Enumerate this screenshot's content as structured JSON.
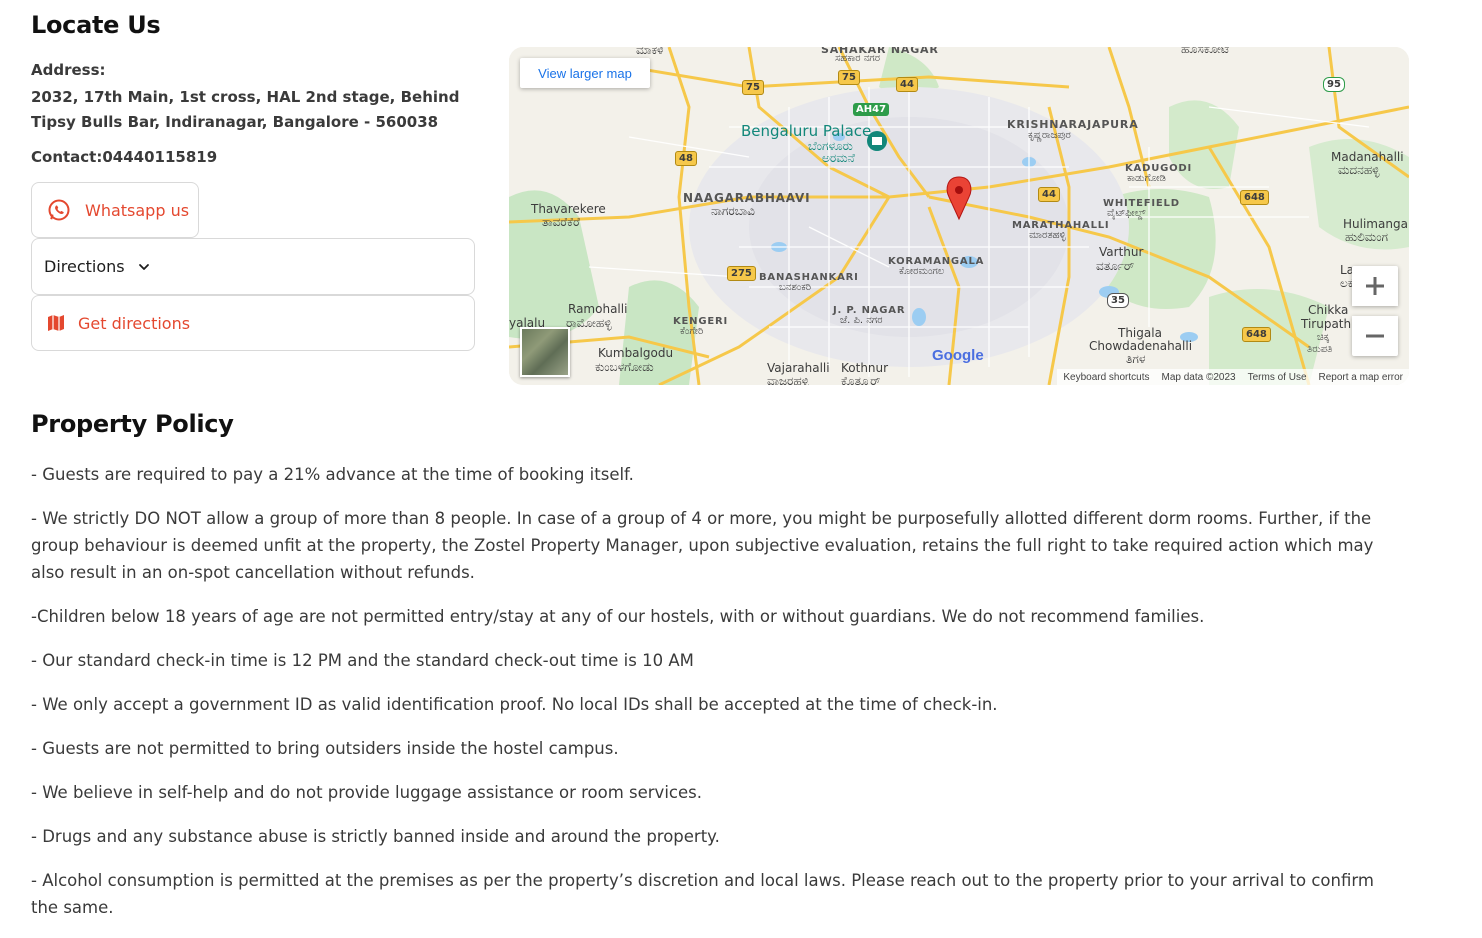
{
  "locate": {
    "title": "Locate Us",
    "address_label": "Address:",
    "address_text": "2032, 17th Main, 1st cross, HAL 2nd stage, Behind Tipsy Bulls Bar, Indiranagar, Bangalore - 560038",
    "contact": "Contact:04440115819",
    "whatsapp_label": "Whatsapp us",
    "directions_label": "Directions",
    "get_directions_label": "Get directions"
  },
  "map": {
    "view_larger": "View larger map",
    "labels": {
      "bengaluru_palace": "Bengaluru Palace",
      "bengaluru_palace_kn": "ಬೆಂಗಳೂರು",
      "aramane": "ಅರಮನೆ",
      "naagarabhaavi": "NAAGARABHAAVI",
      "naagarabhaavi_kn": "ನಾಗರಬಾವಿ",
      "thavarekere": "Thavarekere",
      "thavarekere_kn": "ತಾವರೆಕೆರೆ",
      "krishnarajapura": "KRISHNARAJAPURA",
      "krishnarajapura_kn": "ಕೃಷ್ಣರಾಜಪುರ",
      "kadugodi": "KADUGODI",
      "kadugodi_kn": "ಕಾಡುಗೋಡಿ",
      "madanahalli": "Madanahalli",
      "madanahalli_kn": "ಮದನಹಳ್ಳಿ",
      "whitefield": "WHITEFIELD",
      "whitefield_kn": "ವೈಟ್‌ಫೀಲ್ಡ್",
      "marathahalli": "MARATHAHALLI",
      "marathahalli_kn": "ಮಾರತಹಳ್ಳಿ",
      "hulimangala": "Hulimangal",
      "hulimangala_kn": "ಹುಲಿಮಂಗ",
      "varthur": "Varthur",
      "varthur_kn": "ವರ್ತೂರ್",
      "koramangala": "KORAMANGALA",
      "koramangala_kn": "ಕೋರಮಂಗಲ",
      "banashankari": "BANASHANKARI",
      "banashankari_kn": "ಬನಶಂಕರಿ",
      "ramohalli": "Ramohalli",
      "ramohalli_kn": "ರಾಮೋಹಳ್ಳಿ",
      "kengeri": "KENGERI",
      "kengeri_kn": "ಕೆಂಗೇರಿ",
      "jp_nagar": "J. P. NAGAR",
      "jp_nagar_kn": "ಜೆ. ಪಿ. ನಗರ",
      "kumbalgodu": "Kumbalgodu",
      "kumbalgodu_kn": "ಕುಂಬಳಗೋಡು",
      "vajarahalli": "Vajarahalli",
      "vajarahalli_kn": "ವಾಜರಹಳ್ಳಿ",
      "kothnur": "Kothnur",
      "kothnur_kn": "ಕೊತ್ನೂರ್",
      "thigala": "Thigala",
      "chowdadenahalli": "Chowdadenahalli",
      "thigala_kn": "ತಿಗಳ",
      "chikka": "Chikka",
      "tirupathi": "Tirupathi",
      "chikka_kn": "ಚಿಕ್ಕ",
      "tirupathi_kn": "ತಿರುಪತಿ",
      "sahakar_nagar": "SAHAKAR NAGAR",
      "sahakar_nagar_kn": "ಸಹಕಾರ ನಗರ",
      "hosakote_kn": "ಹೊಸಕೋಟೆ",
      "makali_kn": "ಮಾಕಳಿ",
      "yalalu": "yalalu",
      "lakkur": "La",
      "lakkur_kn": "ಲಕ"
    },
    "road_shields": [
      "75",
      "75",
      "44",
      "AH47",
      "48",
      "44",
      "648",
      "95",
      "275",
      "35",
      "648"
    ],
    "google": "Google",
    "footer": {
      "keyboard": "Keyboard shortcuts",
      "map_data": "Map data ©2023",
      "terms": "Terms of Use",
      "report": "Report a map error"
    }
  },
  "policy": {
    "title": "Property Policy",
    "items": [
      "- Guests are required to pay a 21% advance at the time of booking itself.",
      "- We strictly DO NOT allow a group of more than 8 people. In case of a group of 4 or more, you might be purposefully allotted different dorm rooms. Further, if the group behaviour is deemed unfit at the property, the Zostel Property Manager, upon subjective evaluation, retains the full right to take required action which may also result in an on-spot cancellation without refunds.",
      "-Children below 18 years of age are not permitted entry/stay at any of our hostels, with or without guardians. We do not recommend families.",
      "- Our standard check-in time is 12 PM and the standard check-out time is 10 AM",
      "- We only accept a government ID as valid identification proof. No local IDs shall be accepted at the time of check-in.",
      "- Guests are not permitted to bring outsiders inside the hostel campus.",
      "- We believe in self-help and do not provide luggage assistance or room services.",
      "- Drugs and any substance abuse is strictly banned inside and around the property.",
      "- Alcohol consumption is permitted at the premises as per the property’s discretion and local laws. Please reach out to the property prior to your arrival to confirm the same."
    ]
  },
  "colors": {
    "accent": "#e4482f",
    "text": "#3a3a3a",
    "border": "#d9d9d9",
    "map_link": "#1a73e8",
    "marker": "#ea4335"
  },
  "icons": [
    "whatsapp-icon",
    "chevron-down-icon",
    "map-icon",
    "location-pin-icon",
    "plus-icon",
    "minus-icon",
    "palace-icon"
  ]
}
